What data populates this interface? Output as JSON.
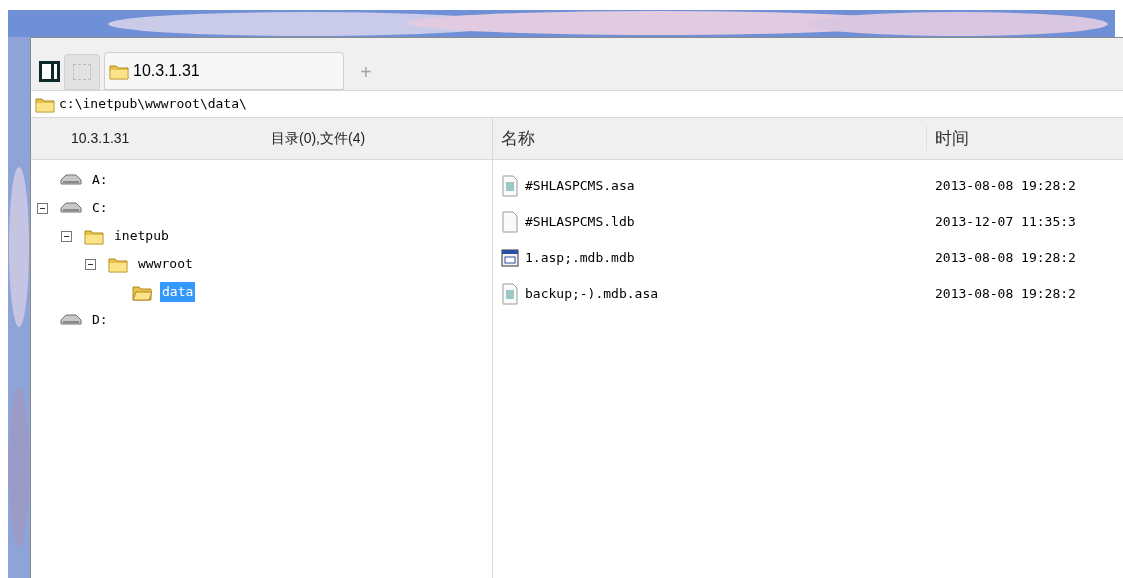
{
  "tabs": [
    {
      "label": "10.3.1.31",
      "selected": true
    }
  ],
  "new_tab": "+",
  "address": "c:\\inetpub\\wwwroot\\data\\",
  "tree_header": {
    "host": "10.3.1.31",
    "summary": "目录(0),文件(4)"
  },
  "columns": [
    "名称",
    "时间"
  ],
  "tree": [
    {
      "kind": "drive",
      "label": "A:",
      "selected": false
    },
    {
      "kind": "drive",
      "label": "C:",
      "selected": false,
      "expanded": true,
      "children": [
        {
          "kind": "folder",
          "label": "inetpub",
          "selected": false,
          "expanded": true,
          "children": [
            {
              "kind": "folder",
              "label": "wwwroot",
              "selected": false,
              "expanded": true,
              "children": [
                {
                  "kind": "folder",
                  "label": "data",
                  "selected": true
                }
              ]
            }
          ]
        }
      ]
    },
    {
      "kind": "drive",
      "label": "D:",
      "selected": false
    }
  ],
  "files": [
    {
      "kind": "script",
      "name": "#SHLASPCMS.asa",
      "time": "2013-08-08 19:28:2"
    },
    {
      "kind": "blank",
      "name": "#SHLASPCMS.ldb",
      "time": "2013-12-07 11:35:3"
    },
    {
      "kind": "app",
      "name": "1.asp;.mdb.mdb",
      "time": "2013-08-08 19:28:2"
    },
    {
      "kind": "script",
      "name": "backup;-).mdb.asa",
      "time": "2013-08-08 19:28:2"
    }
  ]
}
